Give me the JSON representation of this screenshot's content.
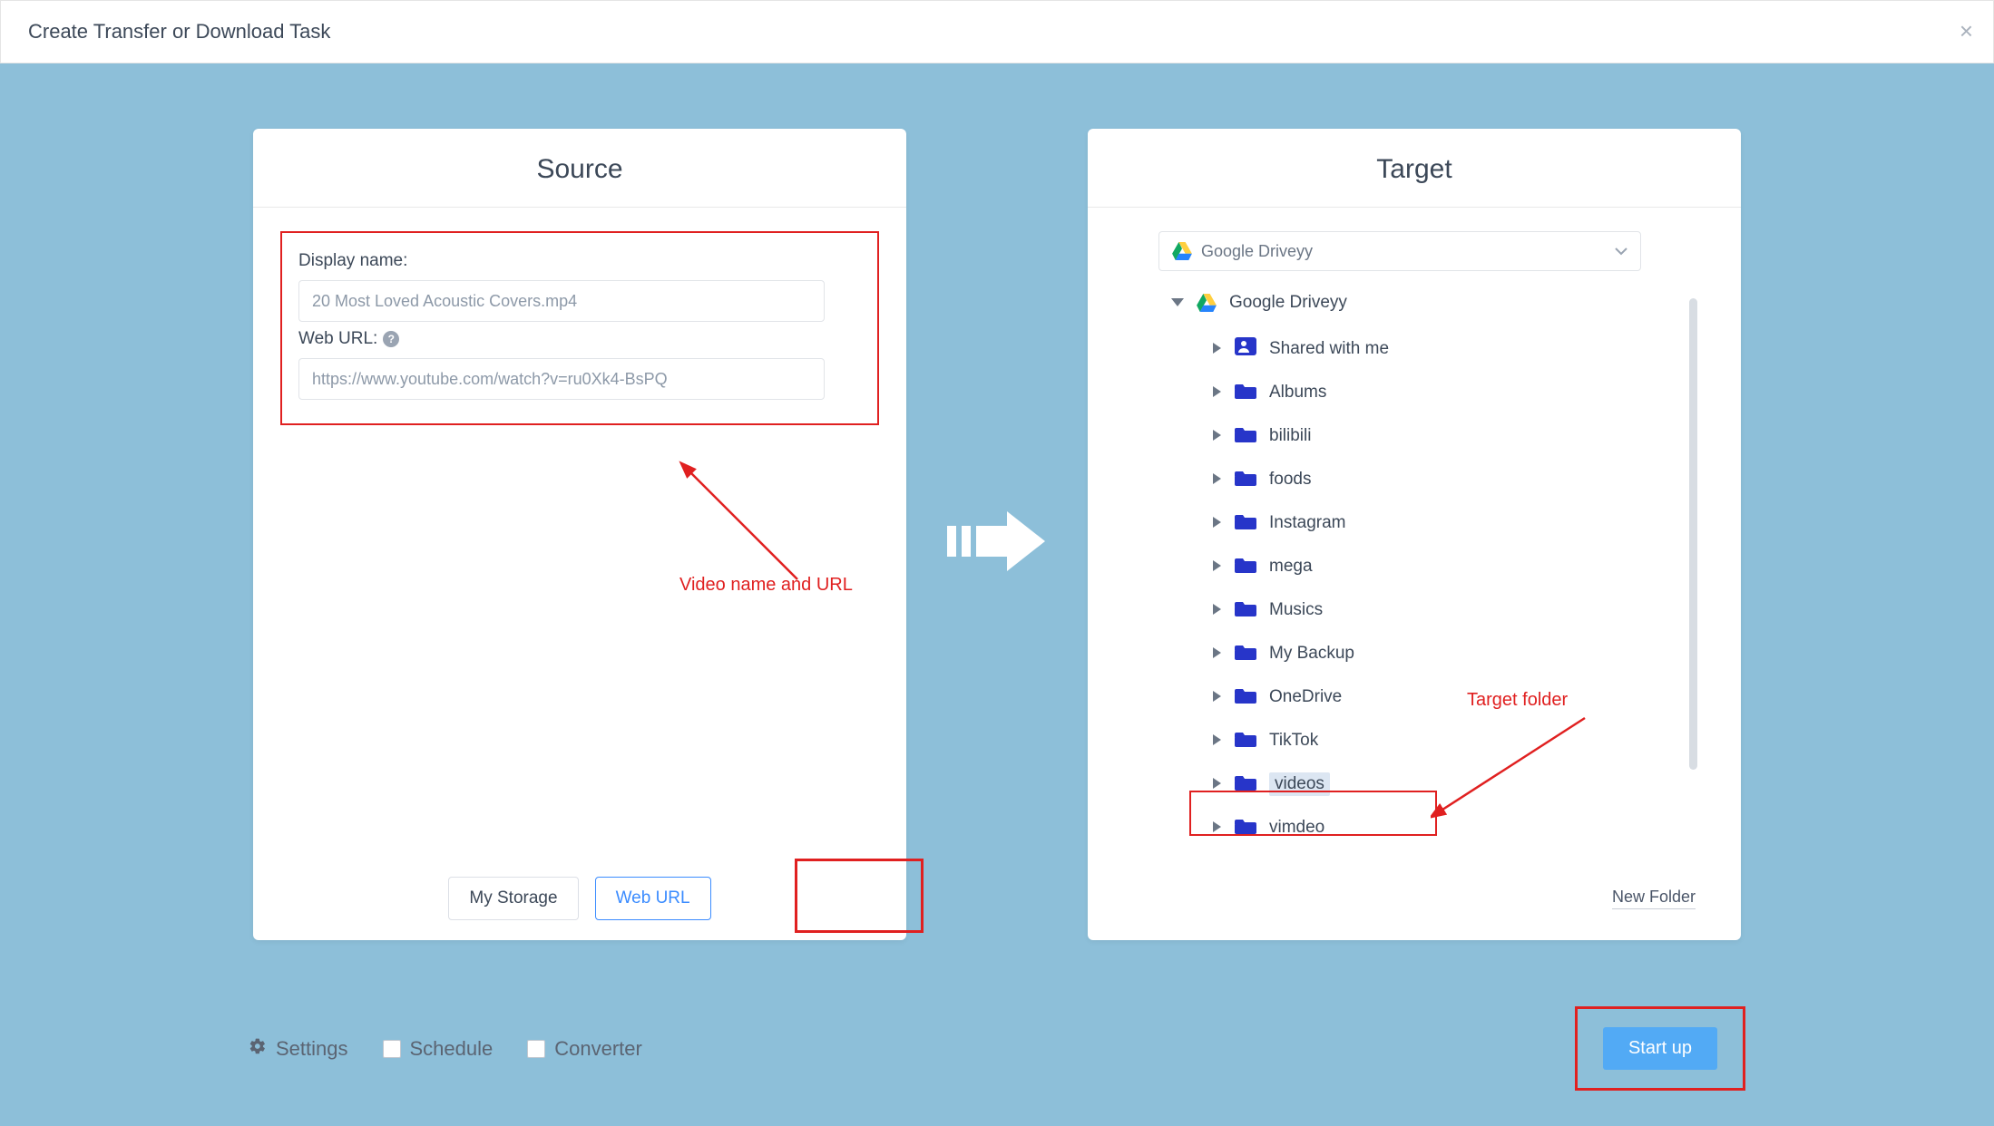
{
  "header": {
    "title": "Create Transfer or Download Task"
  },
  "source": {
    "title": "Source",
    "display_name_label": "Display name:",
    "display_name_value": "20 Most Loved Acoustic Covers.mp4",
    "web_url_label": "Web URL:",
    "web_url_value": "https://www.youtube.com/watch?v=ru0Xk4-BsPQ",
    "annotation": "Video name and URL",
    "tabs": {
      "my_storage": "My Storage",
      "web_url": "Web URL"
    }
  },
  "target": {
    "title": "Target",
    "drive_selected": "Google Driveyy",
    "root_name": "Google Driveyy",
    "nodes": [
      {
        "name": "Shared with me",
        "icon": "shared"
      },
      {
        "name": "Albums"
      },
      {
        "name": "bilibili"
      },
      {
        "name": "foods"
      },
      {
        "name": "Instagram"
      },
      {
        "name": "mega"
      },
      {
        "name": "Musics"
      },
      {
        "name": "My Backup"
      },
      {
        "name": "OneDrive"
      },
      {
        "name": "TikTok"
      },
      {
        "name": "videos",
        "selected": true
      },
      {
        "name": "vimdeo"
      }
    ],
    "annotation": "Target folder",
    "new_folder": "New Folder"
  },
  "footer": {
    "settings": "Settings",
    "schedule": "Schedule",
    "converter": "Converter",
    "start": "Start up"
  }
}
